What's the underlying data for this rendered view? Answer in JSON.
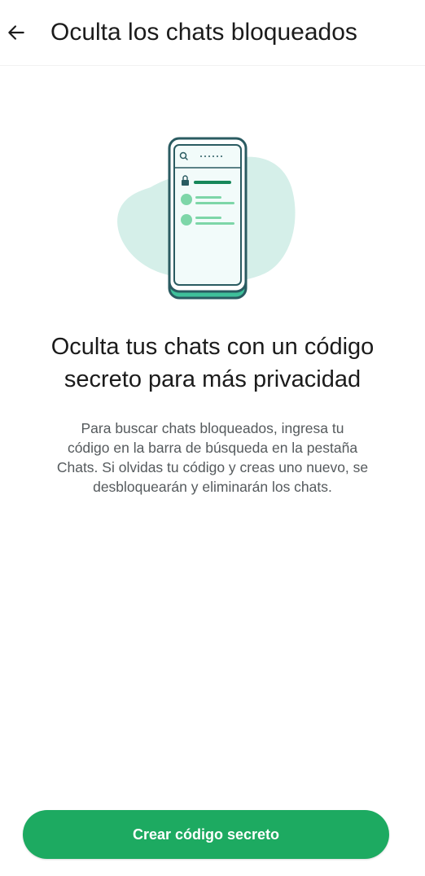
{
  "colors": {
    "accent": "#1daa61",
    "illustration_blob": "#d5efe9",
    "phone_frame": "#2a5b61",
    "phone_screen": "#f2fbfa",
    "phone_base": "#3ec09a",
    "text_primary": "#1b1b1b",
    "text_secondary": "#555a5d"
  },
  "header": {
    "back_icon": "arrow-left-icon",
    "title": "Oculta los chats bloqueados"
  },
  "illustration": {
    "search_icon": "search-icon",
    "search_placeholder": "••••••",
    "lock_icon": "lock-icon"
  },
  "main": {
    "headline_line1": "Oculta tus chats con un código",
    "headline_line2": "secreto para más privacidad",
    "description_lines": [
      "Para buscar chats bloqueados, ingresa tu",
      "código en la barra de búsqueda en la pestaña",
      "Chats. Si olvidas tu código y creas uno nuevo, se",
      "desbloquearán y eliminarán los chats."
    ]
  },
  "footer": {
    "create_button_label": "Crear código secreto"
  }
}
